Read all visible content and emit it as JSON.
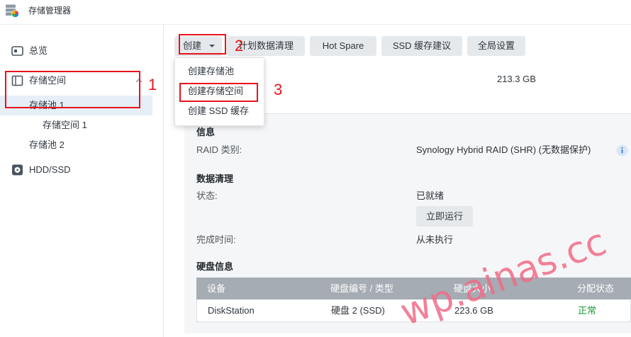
{
  "app": {
    "title": "存储管理器",
    "icon": "storage-manager-app-icon"
  },
  "sidebar": {
    "items": [
      {
        "label": "总览",
        "icon": "overview-icon"
      },
      {
        "label": "存储空间",
        "icon": "storage-icon",
        "expanded": true
      },
      {
        "label": "存储池 1",
        "selected": true
      },
      {
        "label": "存储空间 1"
      },
      {
        "label": "存储池 2"
      },
      {
        "label": "HDD/SSD",
        "icon": "hdd-ssd-icon"
      }
    ]
  },
  "toolbar": {
    "create": {
      "label": "创建",
      "icon": "caret-down-icon",
      "menu_open": true
    },
    "schedule_scrubbing": "计划数据清理",
    "hot_spare": "Hot Spare",
    "ssd_cache_advisor": "SSD 缓存建议",
    "global_settings": "全局设置"
  },
  "create_menu": {
    "items": [
      "创建存储池",
      "创建存储空间",
      "创建 SSD 缓存"
    ]
  },
  "storage_pool": {
    "capacity": "213.3 GB",
    "info": {
      "heading": "信息",
      "raid_type_label": "RAID 类别:",
      "raid_type_value": "Synology Hybrid RAID (SHR) (无数据保护)",
      "help_icon": "info-icon"
    },
    "data_scrubbing": {
      "heading": "数据清理",
      "status_label": "状态:",
      "status_value": "已就绪",
      "run_now_button": "立即运行",
      "last_run_label": "完成时间:",
      "last_run_value": "从未执行"
    },
    "drive_info": {
      "heading": "硬盘信息",
      "columns": [
        "设备",
        "硬盘编号 / 类型",
        "硬盘大小",
        "分配状态"
      ],
      "rows": [
        [
          "DiskStation",
          "硬盘 2 (SSD)",
          "223.6 GB",
          "正常"
        ]
      ]
    }
  },
  "annotations": {
    "steps": [
      "1",
      "2",
      "3"
    ],
    "color": "#e8141b"
  },
  "watermark": {
    "text": "wp.ainas.cc",
    "color": "#f06c88"
  },
  "colors": {
    "selected_bg": "#e6eef8",
    "button_bg": "#e6e9ec",
    "panel_bg": "#f5f6f7",
    "table_header_bg": "#a5acb3",
    "status_ok": "#1a9c36"
  }
}
